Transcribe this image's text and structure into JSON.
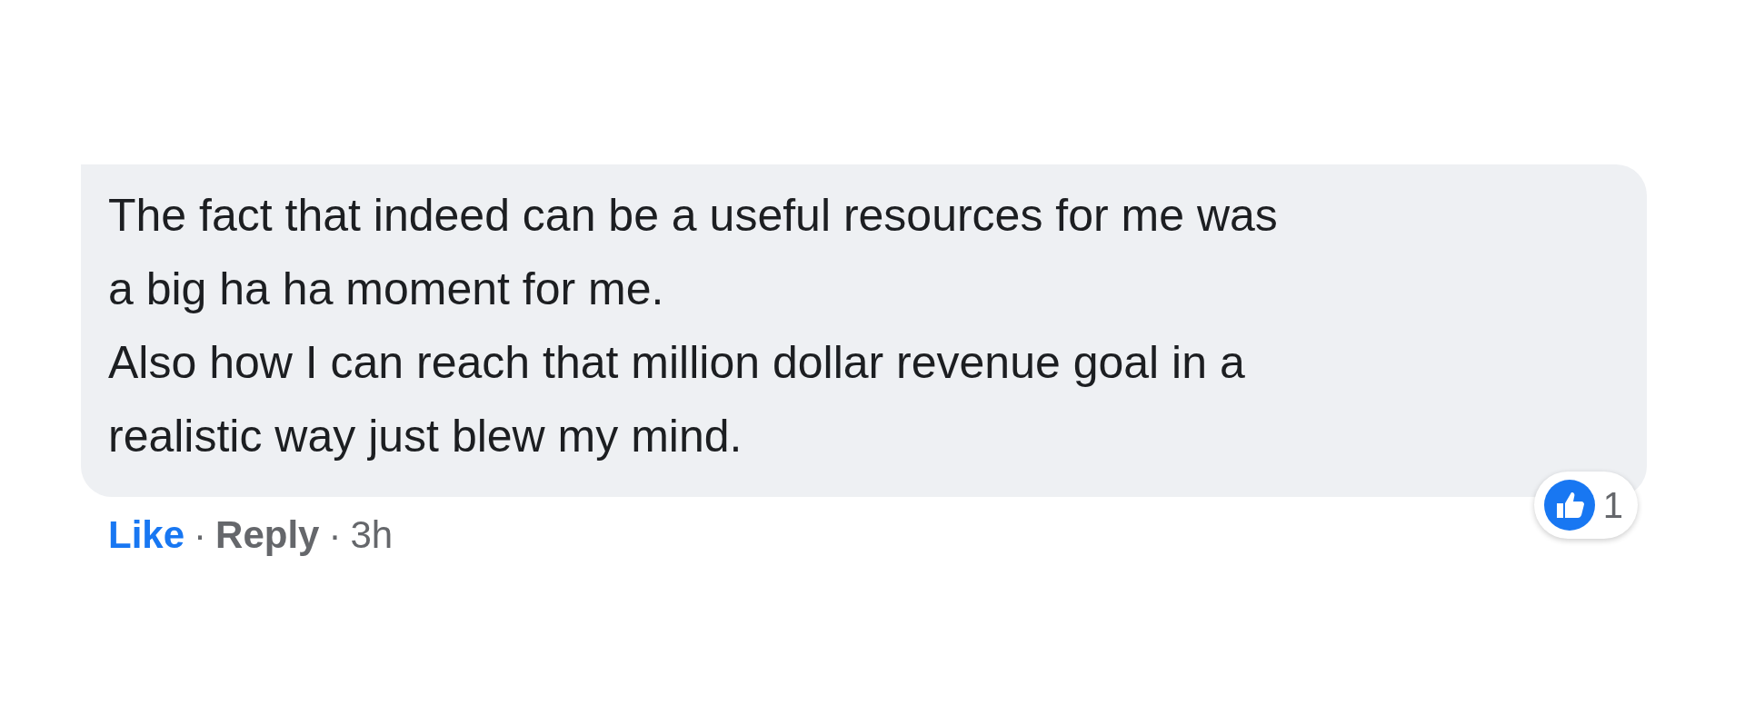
{
  "comment": {
    "text": "The fact that indeed can be a useful resources for me was a big ha ha moment for me.\nAlso how I can reach that million dollar revenue goal in a realistic way just blew my mind.",
    "reactions": {
      "count": "1"
    }
  },
  "actions": {
    "like": {
      "label": "Like",
      "selected": true
    },
    "separator_1": "·",
    "reply": {
      "label": "Reply"
    },
    "separator_2": "·",
    "time": "3h"
  }
}
